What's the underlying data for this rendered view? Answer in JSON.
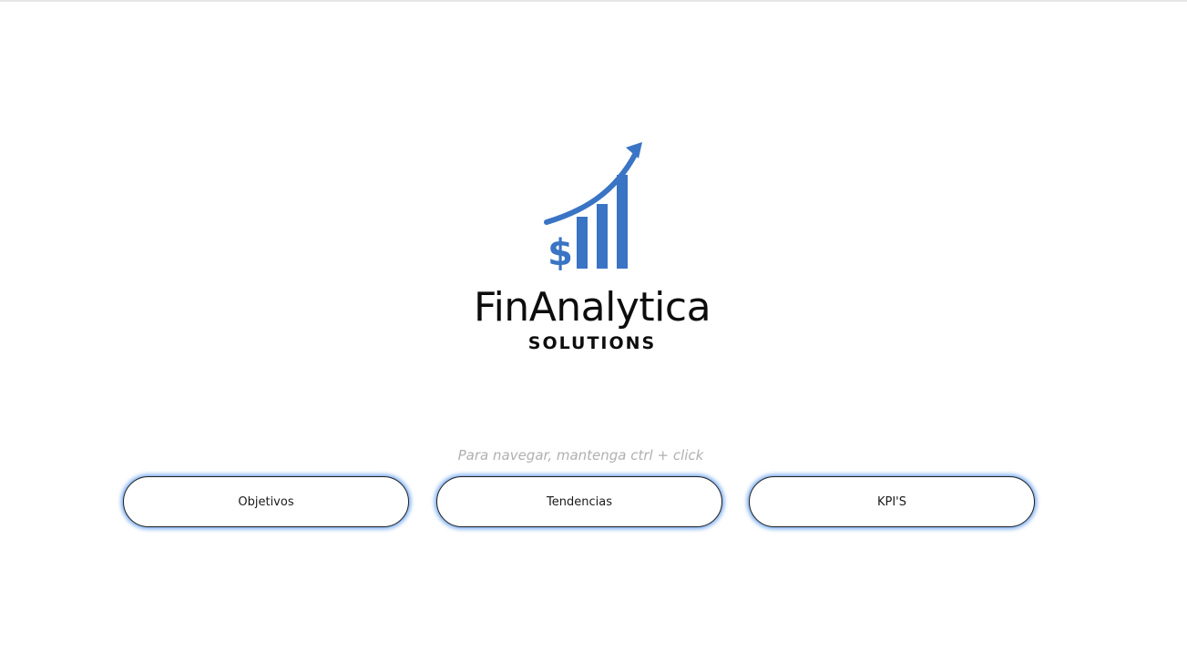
{
  "logo": {
    "name": "FinAnalytica",
    "subtitle": "SOLUTIONS",
    "icon": "dollar-growth-chart-icon",
    "accent_color": "#3a74c4"
  },
  "hint": {
    "text": "Para navegar, mantenga ctrl + click"
  },
  "nav": {
    "buttons": [
      {
        "label": "Objetivos"
      },
      {
        "label": "Tendencias"
      },
      {
        "label": "KPI'S"
      }
    ],
    "glow_color": "#468ceb"
  }
}
